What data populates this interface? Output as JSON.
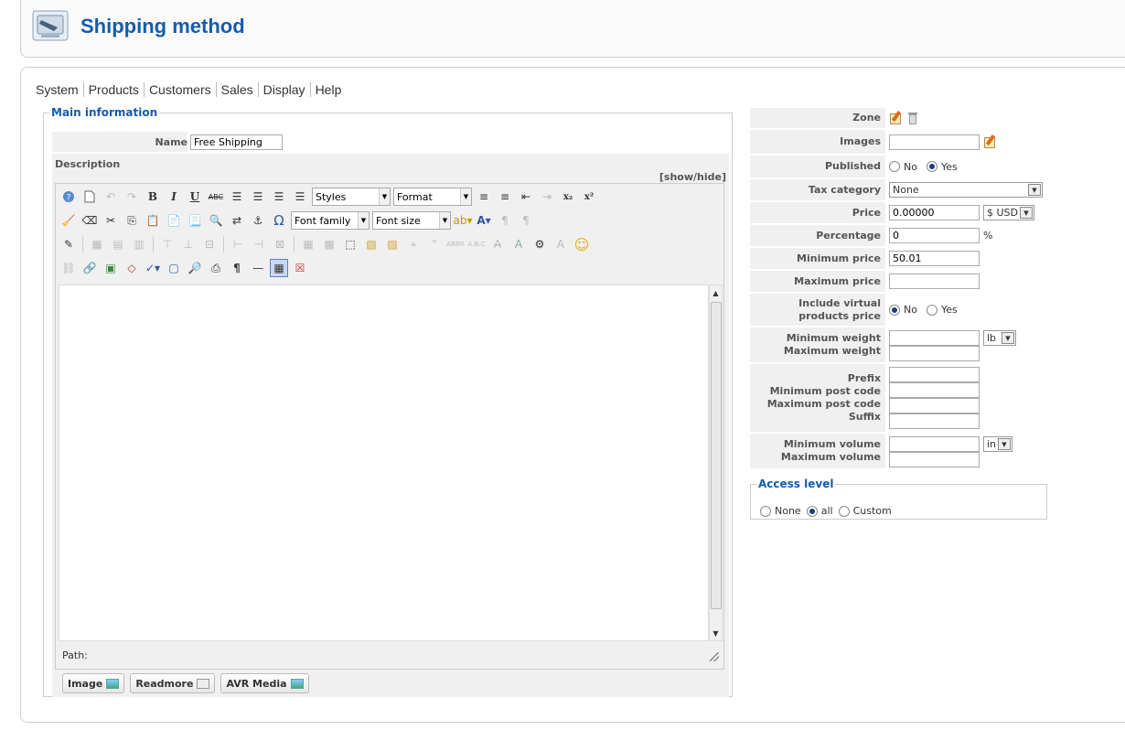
{
  "header": {
    "title": "Shipping method"
  },
  "menu": [
    "System",
    "Products",
    "Customers",
    "Sales",
    "Display",
    "Help"
  ],
  "main_info": {
    "legend": "Main information",
    "name_label": "Name",
    "name_value": "Free Shipping",
    "description_label": "Description",
    "show_hide": "[show/hide]",
    "toolbar": {
      "styles": "Styles",
      "format": "Format",
      "font_family": "Font family",
      "font_size": "Font size"
    },
    "path_label": "Path:",
    "buttons": {
      "image": "Image",
      "readmore": "Readmore",
      "avr_media": "AVR Media"
    }
  },
  "right": {
    "zone_label": "Zone",
    "images_label": "Images",
    "published_label": "Published",
    "published_options": [
      "No",
      "Yes"
    ],
    "published_selected": "Yes",
    "tax_label": "Tax category",
    "tax_value": "None",
    "price_label": "Price",
    "price_value": "0.00000",
    "currency": "$ USD",
    "percentage_label": "Percentage",
    "percentage_value": "0",
    "percent_sign": "%",
    "min_price_label": "Minimum price",
    "min_price_value": "50.01",
    "max_price_label": "Maximum price",
    "virtual_label_1": "Include virtual",
    "virtual_label_2": "products price",
    "virtual_options": [
      "No",
      "Yes"
    ],
    "virtual_selected": "No",
    "min_weight_label": "Minimum weight",
    "max_weight_label": "Maximum weight",
    "weight_unit": "lb",
    "prefix_label": "Prefix",
    "min_post_label": "Minimum post code",
    "max_post_label": "Maximum post code",
    "suffix_label": "Suffix",
    "min_volume_label": "Minimum volume",
    "max_volume_label": "Maximum volume",
    "volume_unit": "in"
  },
  "access": {
    "legend": "Access level",
    "options": [
      "None",
      "all",
      "Custom"
    ],
    "selected": "all"
  }
}
